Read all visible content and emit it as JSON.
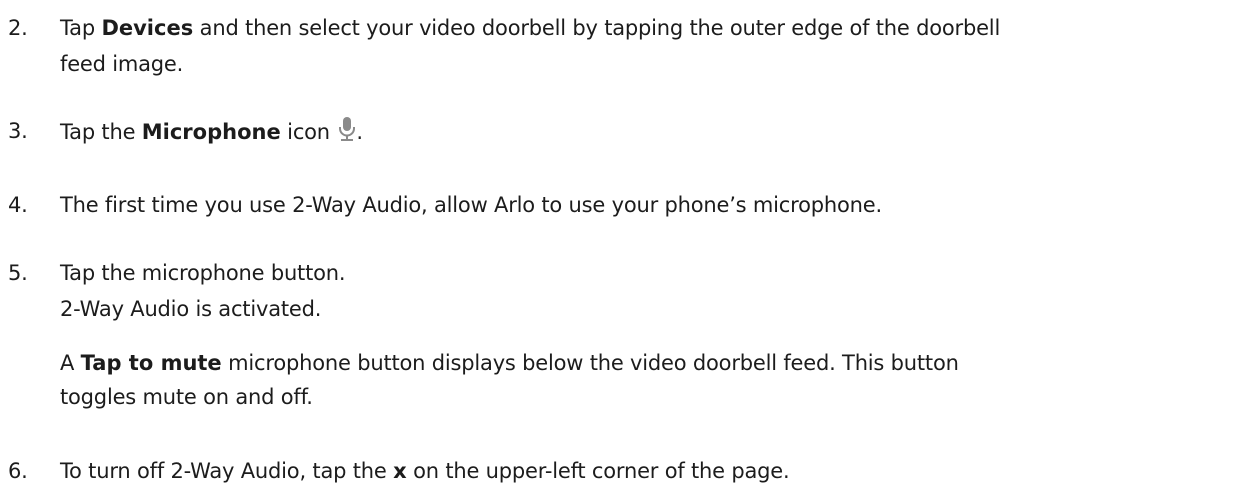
{
  "steps": [
    {
      "number": "2.",
      "pre": "Tap ",
      "bold": "Devices",
      "post": " and then select your video doorbell by tapping the outer edge of the doorbell",
      "cont": "feed image."
    },
    {
      "number": "3.",
      "pre": "Tap the ",
      "bold": "Microphone",
      "post": " icon ",
      "tail": ".",
      "icon": "microphone-icon"
    },
    {
      "number": "4.",
      "text": "The first time you use 2-Way Audio, allow Arlo to use your phone’s microphone."
    },
    {
      "number": "5.",
      "text": "Tap the microphone button.",
      "result": "2-Way Audio is activated.",
      "note_pre": "A ",
      "note_bold": "Tap to mute",
      "note_post": " microphone button displays below the video doorbell feed. This button",
      "note_cont": "toggles mute on and off."
    },
    {
      "number": "6.",
      "pre": "To turn off 2-Way Audio, tap the ",
      "bold": "x",
      "post": " on the upper-left corner of the page."
    }
  ],
  "colors": {
    "text": "#1c1c1c",
    "icon": "#8a8a8a"
  }
}
